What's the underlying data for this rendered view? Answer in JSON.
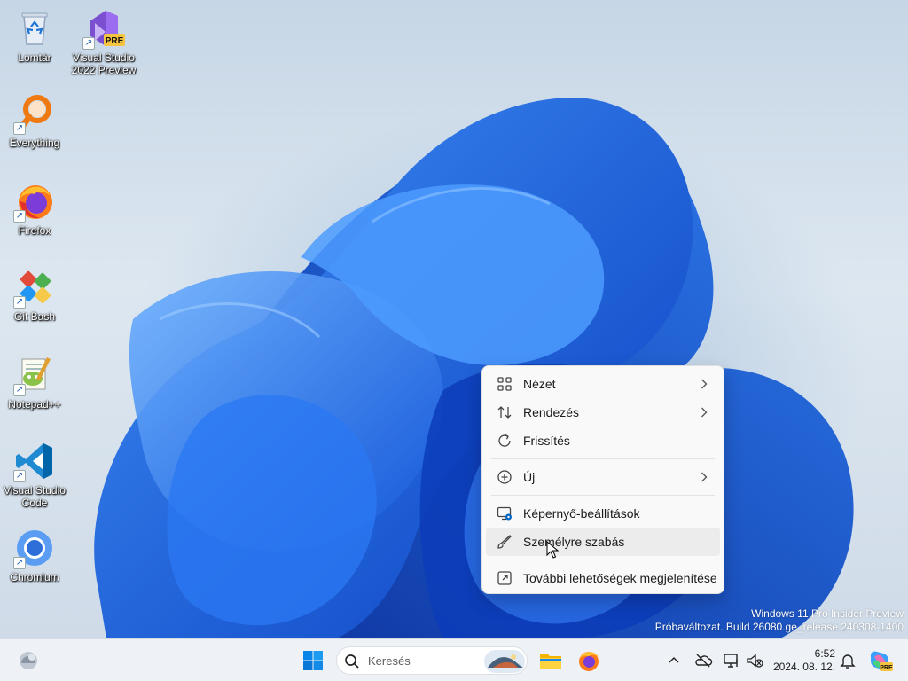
{
  "desktop": {
    "icons": [
      {
        "label_line1": "Lomtár",
        "label_line2": "",
        "icon": "recycle-bin-icon"
      },
      {
        "label_line1": "Visual Studio",
        "label_line2": "2022 Preview",
        "icon": "visual-studio-preview-icon",
        "badge": "PRE"
      },
      {
        "label_line1": "Everything",
        "label_line2": "",
        "icon": "everything-search-icon"
      },
      {
        "label_line1": "Firefox",
        "label_line2": "",
        "icon": "firefox-icon"
      },
      {
        "label_line1": "Git Bash",
        "label_line2": "",
        "icon": "git-bash-icon"
      },
      {
        "label_line1": "Notepad++",
        "label_line2": "",
        "icon": "notepad-plus-plus-icon"
      },
      {
        "label_line1": "Visual Studio",
        "label_line2": "Code",
        "icon": "vscode-icon"
      },
      {
        "label_line1": "Chromium",
        "label_line2": "",
        "icon": "chromium-icon"
      }
    ],
    "shortcut_glyph": "↗"
  },
  "context_menu": {
    "items": [
      {
        "label": "Nézet",
        "icon": "view-grid-icon",
        "submenu": true
      },
      {
        "label": "Rendezés",
        "icon": "sort-icon",
        "submenu": true
      },
      {
        "label": "Frissítés",
        "icon": "refresh-icon",
        "submenu": false
      },
      {
        "label": "Új",
        "icon": "new-plus-icon",
        "submenu": true
      },
      {
        "label": "Képernyő-beállítások",
        "icon": "display-settings-icon",
        "submenu": false
      },
      {
        "label": "Személyre szabás",
        "icon": "personalize-brush-icon",
        "submenu": false,
        "hovered": true
      },
      {
        "label": "További lehetőségek megjelenítése",
        "icon": "show-more-options-icon",
        "submenu": false
      }
    ]
  },
  "watermark": {
    "line1": "Windows 11 Pro Insider Preview",
    "line2": "Próbaváltozat. Build 26080.ge_release.240308-1400"
  },
  "taskbar": {
    "search_placeholder": "Keresés",
    "clock_time": "6:52",
    "clock_date": "2024. 08. 12.",
    "copilot_badge": "PRE",
    "colors": {
      "accent": "#0067c0",
      "background": "#eef2f6"
    }
  }
}
